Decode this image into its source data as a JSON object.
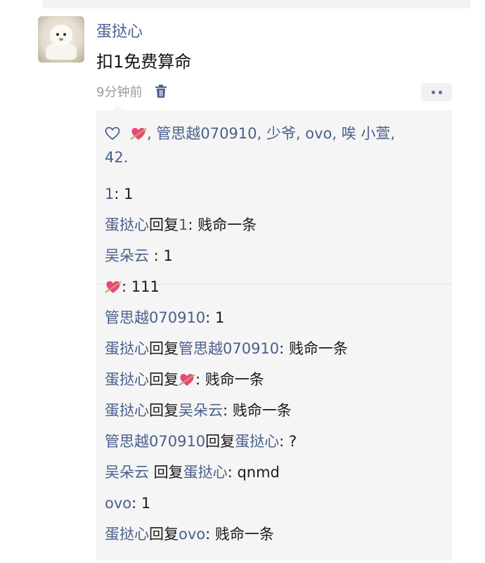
{
  "post": {
    "author": "蛋挞心",
    "text": "扣1免费算命",
    "time": "9分钟前"
  },
  "likes": {
    "names_text": ", 管思越070910, 少爷, ovo, 唉 小萱,",
    "names_text_2": "42."
  },
  "comments": [
    {
      "from": "1",
      "sep": ": ",
      "content": "1"
    },
    {
      "from": "蛋挞心",
      "reply_word": "回复",
      "to": "1",
      "sep": ": ",
      "content": "贱命一条"
    },
    {
      "from": "吴朵云",
      "sep": " : ",
      "content": "1"
    },
    {
      "from_emoji": "heart-with-arrow",
      "sep": ": ",
      "content": "111"
    },
    {
      "from": "管思越070910",
      "sep": ": ",
      "content": "1"
    },
    {
      "from": "蛋挞心",
      "reply_word": "回复",
      "to": "管思越070910",
      "sep": ": ",
      "content": "贱命一条"
    },
    {
      "from": "蛋挞心",
      "reply_word": "回复",
      "to_emoji": "heart-with-arrow",
      "sep": ": ",
      "content": "贱命一条"
    },
    {
      "from": "蛋挞心",
      "reply_word": "回复",
      "to": "吴朵云",
      "sep": ": ",
      "content": "贱命一条"
    },
    {
      "from": "管思越070910",
      "reply_word": "回复",
      "to": "蛋挞心",
      "sep": ": ",
      "content": "?"
    },
    {
      "from": "吴朵云",
      "reply_word": " 回复",
      "to": "蛋挞心",
      "sep": ": ",
      "content": "qnmd"
    },
    {
      "from": "ovo",
      "sep": ": ",
      "content": "1"
    },
    {
      "from": "蛋挞心",
      "reply_word": "回复",
      "to": "ovo",
      "sep": ": ",
      "content": "贱命一条"
    }
  ],
  "colors": {
    "name_link": "#4a5f8c",
    "heart_emoji": "#e8487a"
  },
  "icons": [
    "trash-icon",
    "more-icon",
    "heart-outline-icon",
    "heart-with-arrow-emoji"
  ]
}
